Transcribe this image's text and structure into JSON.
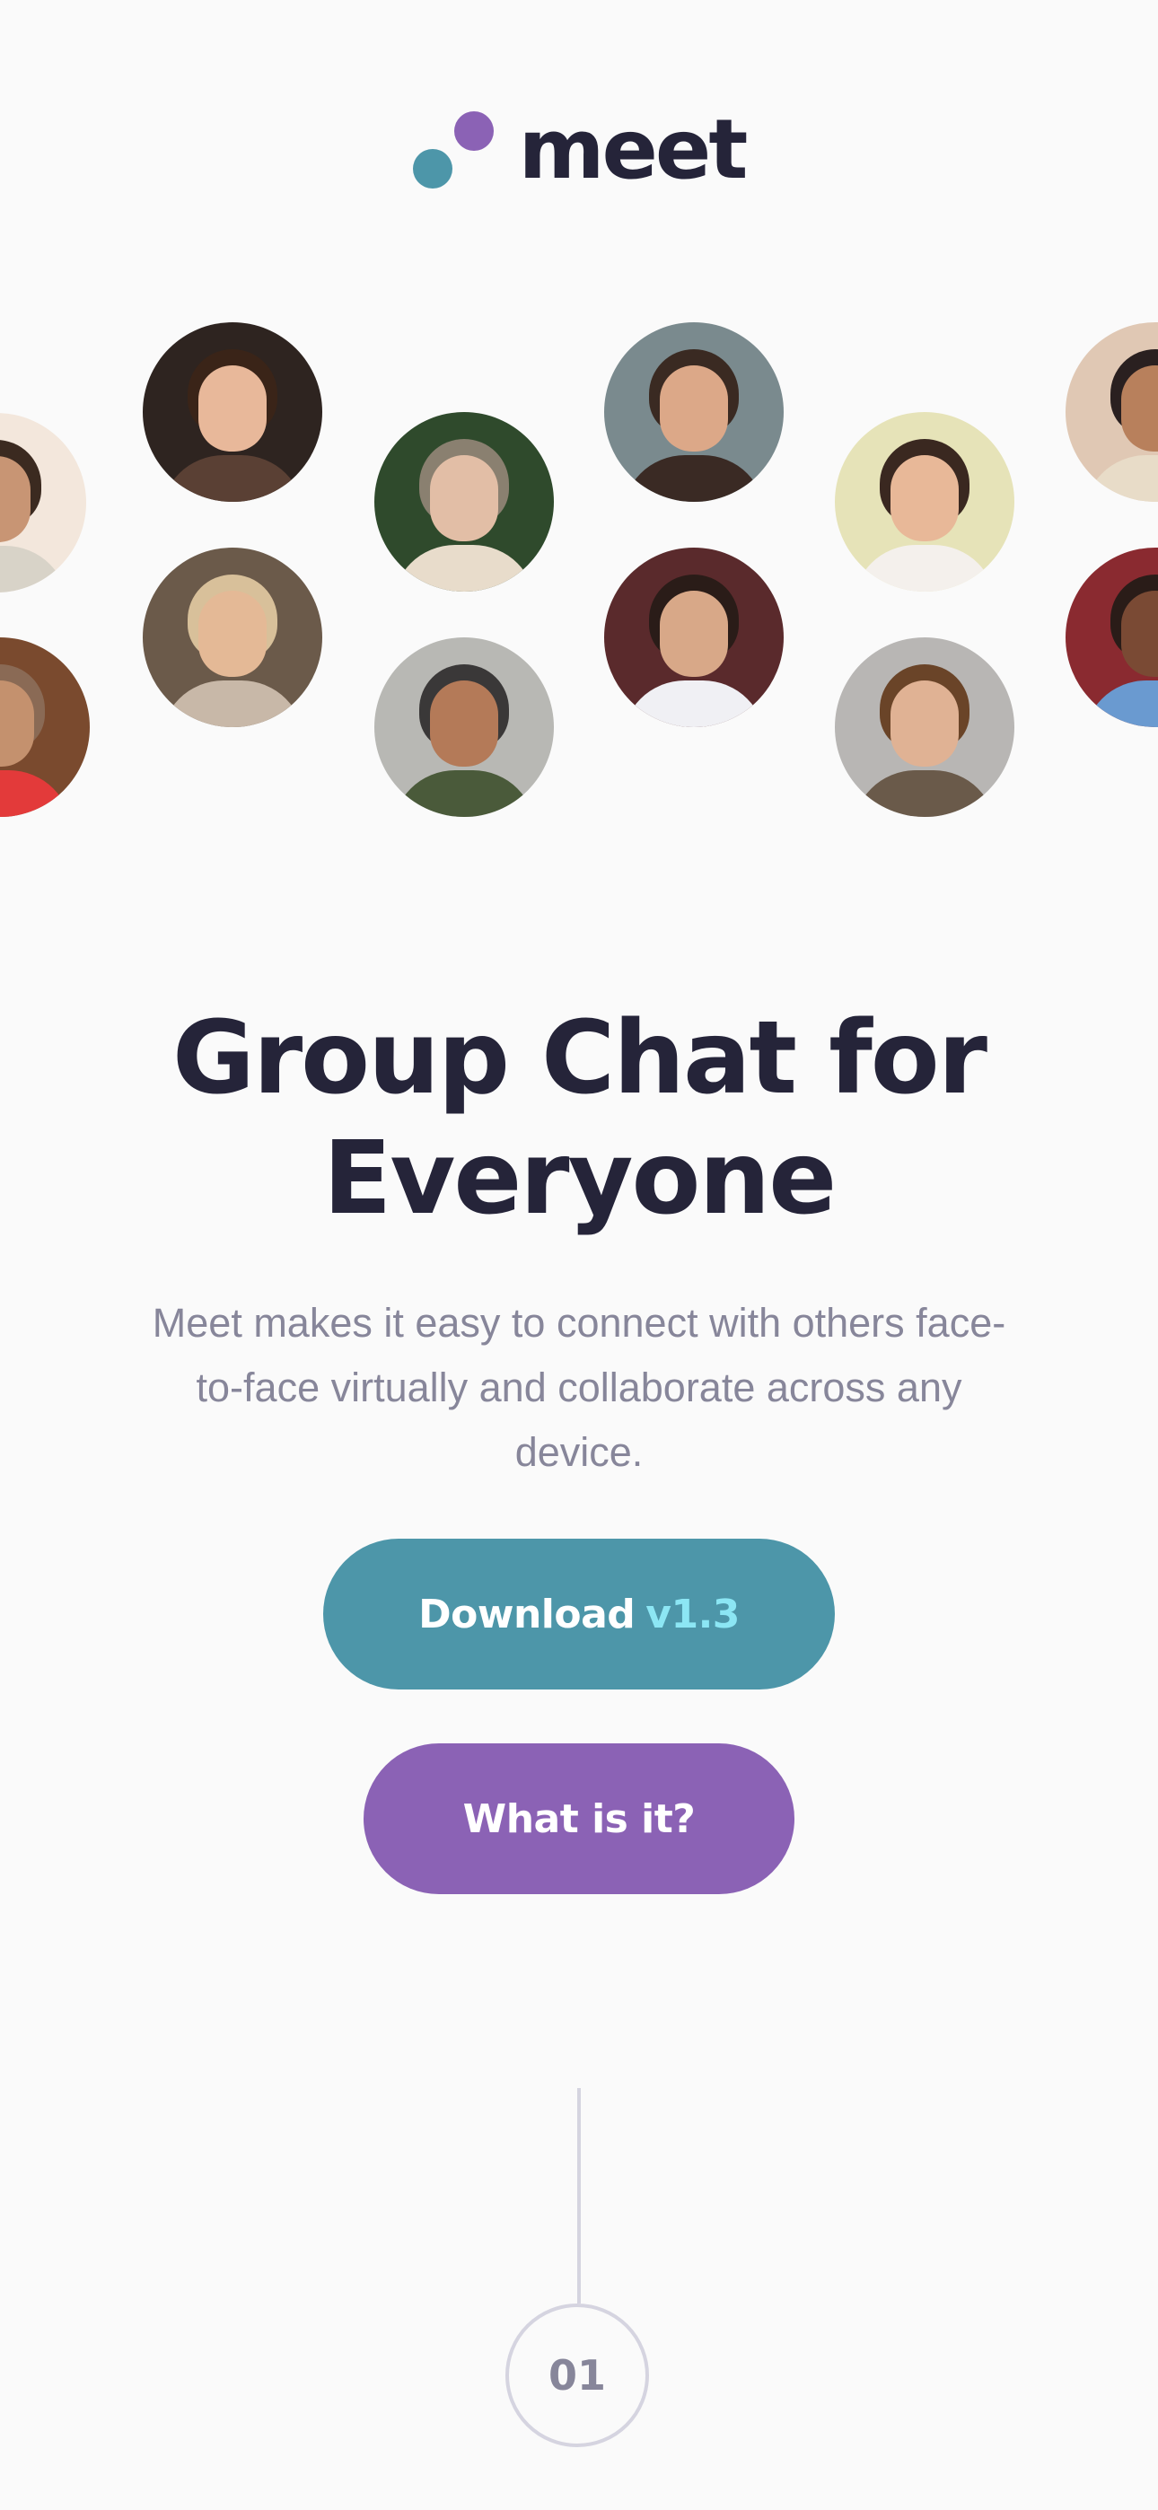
{
  "brand": {
    "name": "meet",
    "colors": {
      "teal": "#4d96a9",
      "purple": "#8b62b5",
      "dark": "#252439",
      "muted": "#87869a",
      "version_accent": "#8ce6f4",
      "background": "#fafafa"
    }
  },
  "hero": {
    "title_line1": "Group Chat for",
    "title_line2": "Everyone",
    "description": "Meet makes it easy to connect with others face-to-face virtually and collaborate across any device."
  },
  "buttons": {
    "download_label": "Download",
    "download_version": "v1.3",
    "what_label": "What is it?"
  },
  "step": {
    "number": "01"
  },
  "avatars": [
    {
      "name": "avatar-man-partial-left-top",
      "bg": "#f3e7dc",
      "hair": "#3b2a20",
      "skin": "#c89574",
      "shirt": "#d8d3c8"
    },
    {
      "name": "avatar-man-beanie",
      "bg": "#7a4a2e",
      "hair": "#8a6a55",
      "skin": "#c4916e",
      "shirt": "#e33a3a"
    },
    {
      "name": "avatar-woman-smiling",
      "bg": "#2e2420",
      "hair": "#3a2418",
      "skin": "#e8b89a",
      "shirt": "#5a4034"
    },
    {
      "name": "avatar-woman-blonde",
      "bg": "#6b5a4a",
      "hair": "#d8c09a",
      "skin": "#e4b996",
      "shirt": "#c8b8a8"
    },
    {
      "name": "avatar-man-glasses",
      "bg": "#2f4a2c",
      "hair": "#8a8070",
      "skin": "#e2bea6",
      "shirt": "#e8dccb"
    },
    {
      "name": "avatar-older-man",
      "bg": "#b8b8b4",
      "hair": "#3a3838",
      "skin": "#b47a58",
      "shirt": "#4a5a3a"
    },
    {
      "name": "avatar-man-sunglasses",
      "bg": "#7a8a8e",
      "hair": "#3a2a22",
      "skin": "#dca888",
      "shirt": "#3a2a24"
    },
    {
      "name": "avatar-man-flowers",
      "bg": "#5a2a2c",
      "hair": "#2a1c18",
      "skin": "#d8a888",
      "shirt": "#f0f0f4"
    },
    {
      "name": "avatar-man-laughing",
      "bg": "#e6e3b8",
      "hair": "#3a2820",
      "skin": "#e8b898",
      "shirt": "#f4f0ec"
    },
    {
      "name": "avatar-man-curly-hair",
      "bg": "#b8b6b4",
      "hair": "#6a4428",
      "skin": "#e0b294",
      "shirt": "#6a5a4a"
    },
    {
      "name": "avatar-man-partial-right-top",
      "bg": "#e0c8b4",
      "hair": "#2a2020",
      "skin": "#b8805c",
      "shirt": "#e8dcc8"
    },
    {
      "name": "avatar-woman-partial-right-bottom",
      "bg": "#8a2a30",
      "hair": "#2a1c18",
      "skin": "#7a4a34",
      "shirt": "#6a9ad0"
    }
  ]
}
